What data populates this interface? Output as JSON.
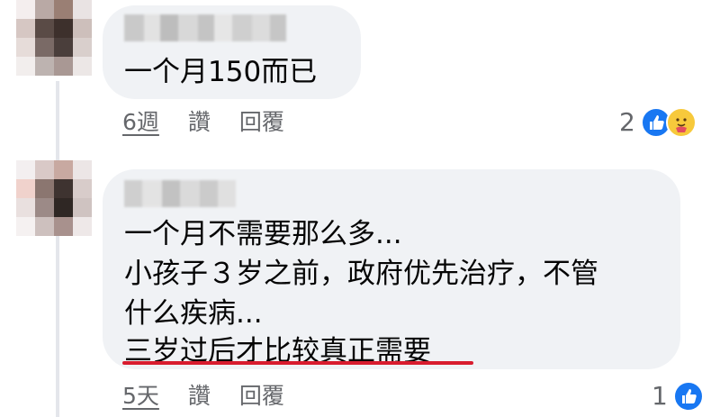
{
  "colors": {
    "bubble": "#f0f2f5",
    "meta_text": "#65676b",
    "like_blue": "#1877f2",
    "care_yellow": "#f7c93b",
    "highlight_red": "#d81c2e"
  },
  "comments": [
    {
      "lines": [
        "一个月150而已"
      ],
      "time": "6週",
      "like_label": "讚",
      "reply_label": "回覆",
      "reaction_count": "2",
      "reaction_icons": [
        "like-icon",
        "care-icon"
      ]
    },
    {
      "lines": [
        "一个月不需要那么多...",
        "小孩子３岁之前，政府优先治疗，不管",
        "什么疾病...",
        "三岁过后才比较真正需要"
      ],
      "time": "5天",
      "like_label": "讚",
      "reply_label": "回覆",
      "reaction_count": "1",
      "reaction_icons": [
        "like-icon"
      ]
    }
  ]
}
